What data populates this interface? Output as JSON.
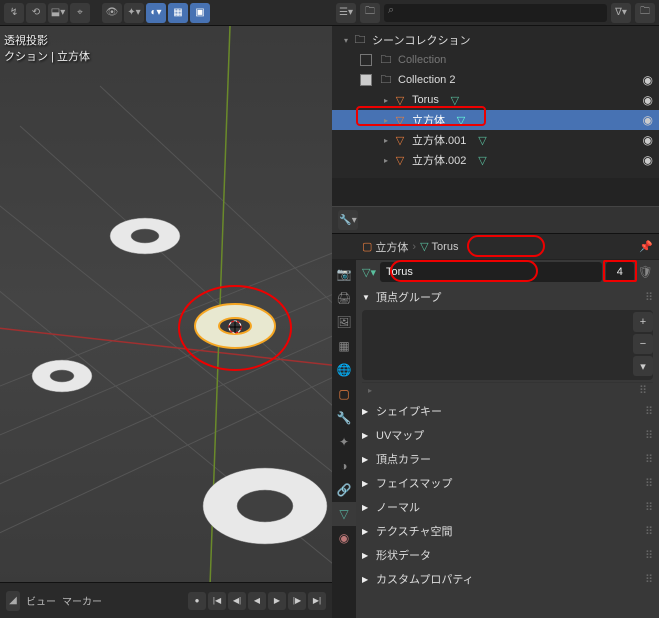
{
  "viewport": {
    "overlay_line1": "透視投影",
    "overlay_line2": "クション | 立方体",
    "footer_view": "ビュー",
    "footer_marker": "マーカー"
  },
  "outliner": {
    "title": "シーンコレクション",
    "items": [
      {
        "label": "Collection",
        "type": "collection",
        "checked": false,
        "disabled": true
      },
      {
        "label": "Collection 2",
        "type": "collection",
        "checked": true
      },
      {
        "label": "Torus",
        "type": "mesh"
      },
      {
        "label": "立方体",
        "type": "mesh",
        "selected": true
      },
      {
        "label": "立方体.001",
        "type": "mesh"
      },
      {
        "label": "立方体.002",
        "type": "mesh"
      }
    ]
  },
  "breadcrumb": {
    "obj": "立方体",
    "data": "Torus"
  },
  "data_name_field": {
    "value": "Torus",
    "users": "4"
  },
  "panels": {
    "vgroups": "頂点グループ",
    "shapekeys": "シェイプキー",
    "uvmaps": "UVマップ",
    "vcolors": "頂点カラー",
    "facemaps": "フェイスマップ",
    "normals": "ノーマル",
    "texspace": "テクスチャ空間",
    "geomdata": "形状データ",
    "customprops": "カスタムプロパティ"
  },
  "chart_data": null
}
